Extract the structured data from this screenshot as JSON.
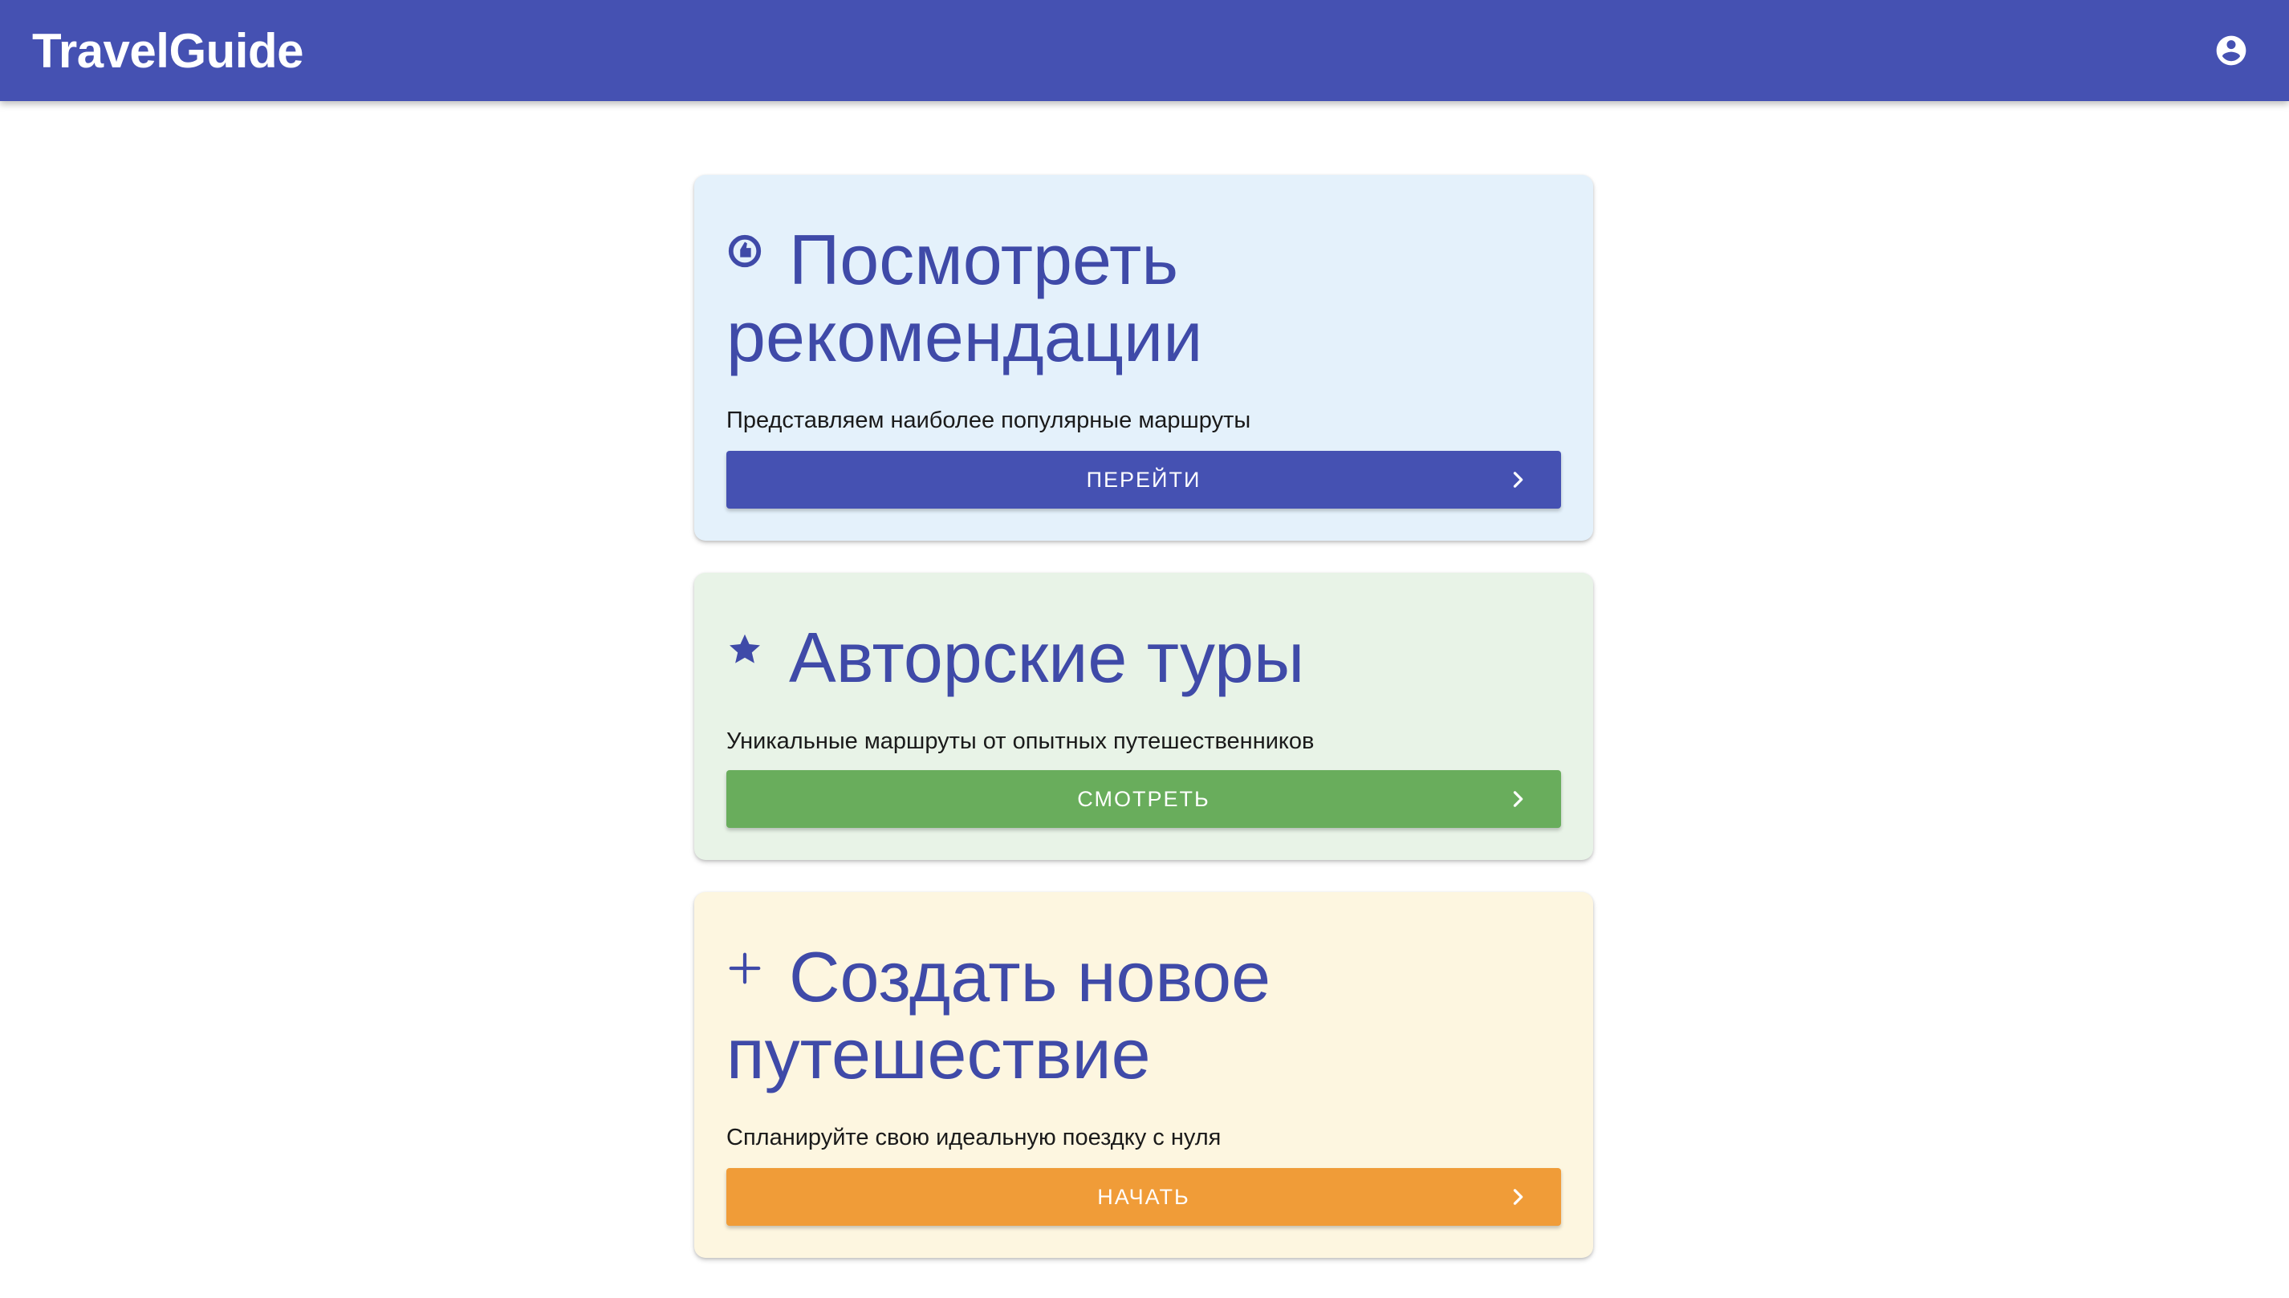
{
  "app": {
    "title": "TravelGuide"
  },
  "header": {
    "account_icon": "account-circle-icon"
  },
  "colors": {
    "appbar": "#4551b2",
    "title_text": "#3f4aa8",
    "blue_card_bg": "#e4f1fb",
    "green_card_bg": "#e8f3e7",
    "yellow_card_bg": "#fdf6e0",
    "blue_button": "#4551b2",
    "green_button": "#69ad5c",
    "orange_button": "#f09c38"
  },
  "cards": [
    {
      "icon": "thumb-up-icon",
      "title": "Посмотреть рекомендации",
      "description": "Представляем наиболее популярные маршруты",
      "button_label": "ПЕРЕЙТИ",
      "button_icon": "chevron-right-icon"
    },
    {
      "icon": "star-icon",
      "title": "Авторские туры",
      "description": "Уникальные маршруты от опытных путешественников",
      "button_label": "СМОТРЕТЬ",
      "button_icon": "chevron-right-icon"
    },
    {
      "icon": "plus-icon",
      "title": "Создать новое путешествие",
      "description": "Спланируйте свою идеальную поездку с нуля",
      "button_label": "НАЧАТЬ",
      "button_icon": "chevron-right-icon"
    }
  ]
}
